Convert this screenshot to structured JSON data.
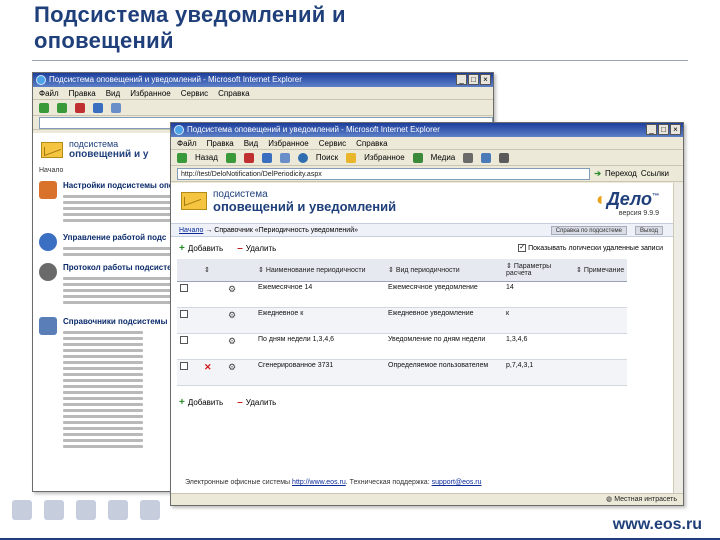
{
  "slide": {
    "title_line1": "Подсистема уведомлений и",
    "title_line2": "оповещений",
    "site": "www.eos.ru"
  },
  "back_window": {
    "title": "Подсистема оповещений и уведомлений - Microsoft Internet Explorer",
    "menu": [
      "Файл",
      "Правка",
      "Вид",
      "Избранное",
      "Сервис",
      "Справка"
    ],
    "logo_line1": "подсистема",
    "logo_line2": "оповещений и у",
    "start": "Начало",
    "sections": [
      {
        "title": "Настройки подсистемы опо",
        "icon_color": "#d9722a"
      },
      {
        "title": "Управление работой подс",
        "icon_color": "#3b6fc2"
      },
      {
        "title": "Протокол работы подсисте",
        "icon_color": "#6a6a6a"
      },
      {
        "title": "Справочники подсистемы",
        "icon_color": "#5a7fb8"
      }
    ]
  },
  "front_window": {
    "title": "Подсистема оповещений и уведомлений - Microsoft Internet Explorer",
    "menu": [
      "Файл",
      "Правка",
      "Вид",
      "Избранное",
      "Сервис",
      "Справка"
    ],
    "toolbar": [
      "Назад",
      "Поиск",
      "Избранное",
      "Медиа"
    ],
    "address": "http://test/DeloNotification/DelPeriodicity.aspx",
    "go_label": "Переход",
    "links_label": "Ссылки",
    "logo_line1": "подсистема",
    "logo_line2": "оповещений и уведомлений",
    "brand_main": "Дело",
    "brand_tm": "™",
    "version": "версия 9.9.9",
    "nav_start": "Начало",
    "nav_path": "→ Справочник «Периодичность уведомлений»",
    "nav_btn_help": "Справка по подсистеме",
    "nav_btn_exit": "Выход",
    "add_label": "Добавить",
    "delete_label": "Удалить",
    "show_deleted_label": "Показывать логически удаленные записи",
    "columns": [
      "",
      "",
      "",
      "Наименование периодичности",
      "Вид периодичности",
      "Параметры расчета",
      "Примечание"
    ],
    "rows": [
      {
        "deleted": false,
        "name": "Ежемесячное 14",
        "kind": "Ежемесячное уведомление",
        "params": "14",
        "note": ""
      },
      {
        "deleted": false,
        "name": "Ежедневное к",
        "kind": "Ежедневное уведомление",
        "params": "к",
        "note": ""
      },
      {
        "deleted": false,
        "name": "По дням недели 1,3,4,6",
        "kind": "Уведомление по дням недели",
        "params": "1,3,4,6",
        "note": ""
      },
      {
        "deleted": true,
        "name": "Сгенерированное 3731",
        "kind": "Определяемое пользователем",
        "params": "p,7,4,3,1",
        "note": ""
      }
    ],
    "footer_prefix": "Электронные офисные системы",
    "footer_link1": "http://www.eos.ru",
    "footer_mid": ". Техническая поддержка:",
    "footer_link2": "support@eos.ru",
    "status_text": "Местная интрасеть"
  }
}
